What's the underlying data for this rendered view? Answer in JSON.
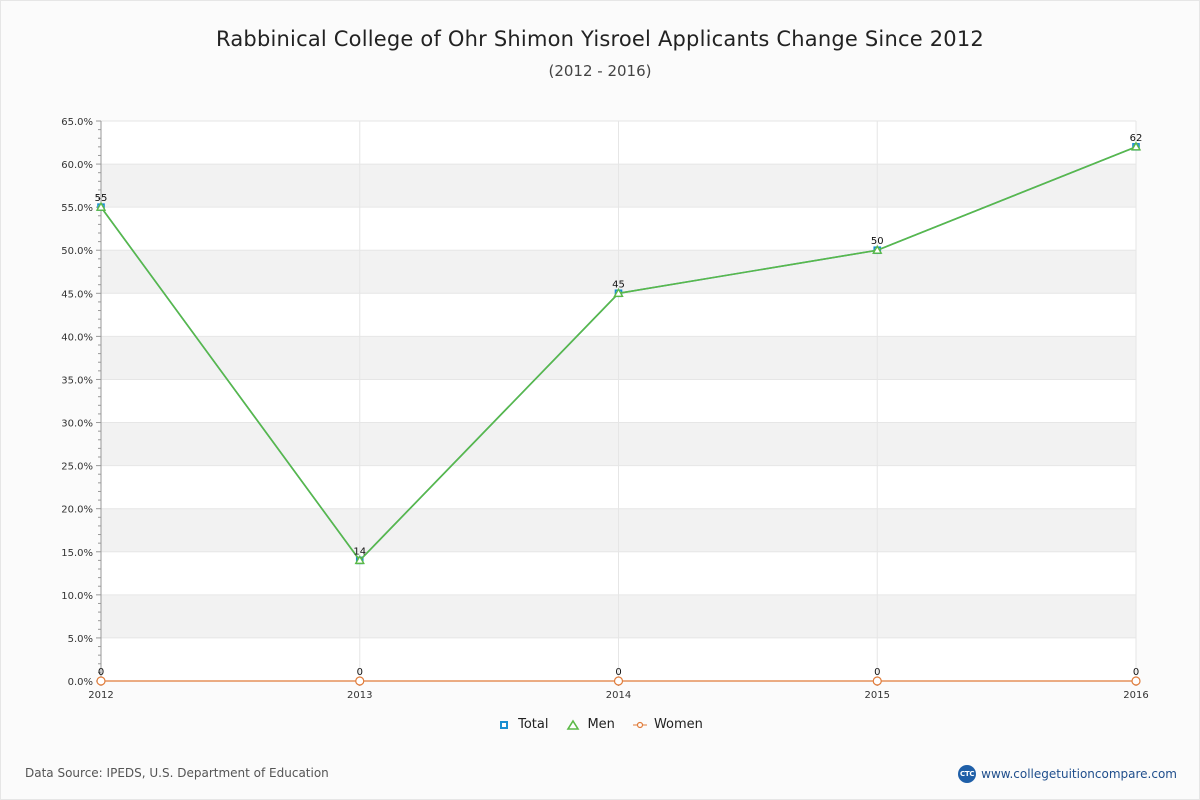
{
  "title": "Rabbinical College of Ohr Shimon Yisroel Applicants Change Since 2012",
  "subtitle": "(2012 - 2016)",
  "footer": {
    "source": "Data Source: IPEDS, U.S. Department of Education",
    "brand": "www.collegetuitioncompare.com",
    "brand_logo": "CTC"
  },
  "colors": {
    "total": "#1a8fd1",
    "men": "#5bb947",
    "women": "#e07b39",
    "grid_band": "#f2f2f2",
    "axis": "#999999"
  },
  "chart_data": {
    "type": "line",
    "x": [
      "2012",
      "2013",
      "2014",
      "2015",
      "2016"
    ],
    "ylim": [
      0,
      65
    ],
    "yticks": [
      "0.0%",
      "5.0%",
      "10.0%",
      "15.0%",
      "20.0%",
      "25.0%",
      "30.0%",
      "35.0%",
      "40.0%",
      "45.0%",
      "50.0%",
      "55.0%",
      "60.0%",
      "65.0%"
    ],
    "grid": true,
    "legend_position": "bottom-center",
    "series": [
      {
        "name": "Total",
        "key": "total",
        "marker": "square",
        "values": [
          55,
          14,
          45,
          50,
          62
        ],
        "labels": [
          "55",
          "14",
          "45",
          "50",
          "62"
        ]
      },
      {
        "name": "Men",
        "key": "men",
        "marker": "triangle",
        "values": [
          55,
          14,
          45,
          50,
          62
        ],
        "labels": []
      },
      {
        "name": "Women",
        "key": "women",
        "marker": "circle",
        "values": [
          0,
          0,
          0,
          0,
          0
        ],
        "labels": [
          "0",
          "0",
          "0",
          "0",
          "0"
        ]
      }
    ]
  }
}
